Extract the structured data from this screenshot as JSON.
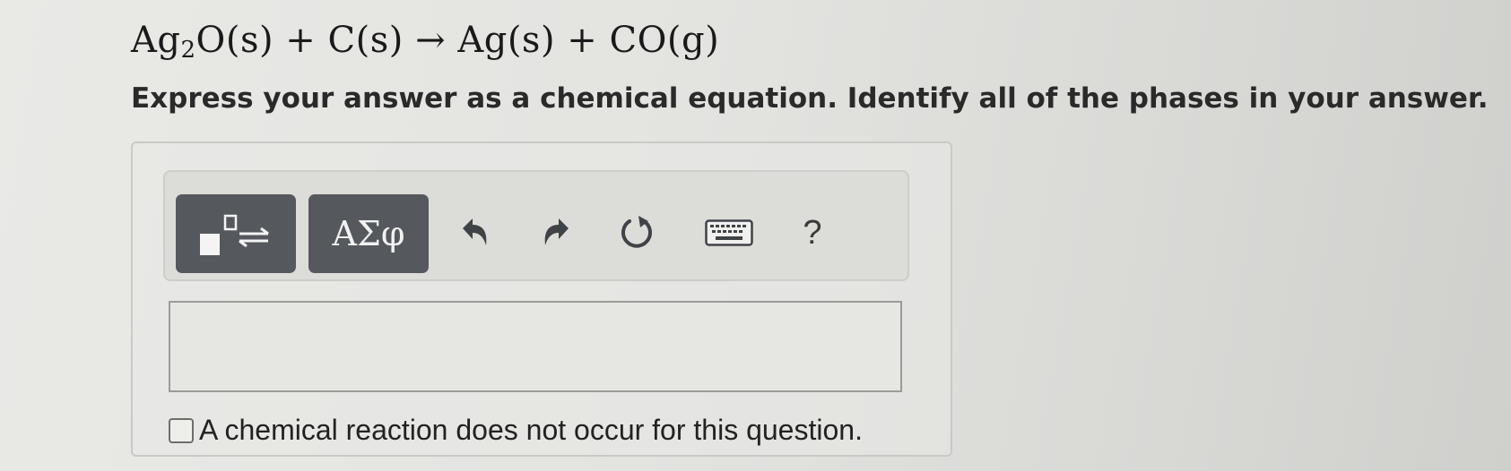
{
  "question": {
    "equation_parts": {
      "reactant1": "Ag",
      "reactant1_sub": "2",
      "reactant1_rest": "O(s)",
      "plus1": "+",
      "reactant2": "C(s)",
      "arrow": "→",
      "product1": "Ag(s)",
      "plus2": "+",
      "product2": "CO(g)"
    },
    "instructions": "Express your answer as a chemical equation. Identify all of the phases in your answer."
  },
  "toolbar": {
    "symbols_label": "ΑΣφ",
    "help_label": "?",
    "icons": [
      "templates-icon",
      "undo-icon",
      "redo-icon",
      "reset-icon",
      "keyboard-icon"
    ]
  },
  "answer": {
    "value": ""
  },
  "no_reaction": {
    "label": "A chemical reaction does not occur for this question.",
    "checked": false
  },
  "colors": {
    "button_dark": "#55595e",
    "icon_dark": "#3f4347",
    "background": "#e3e3e0"
  }
}
